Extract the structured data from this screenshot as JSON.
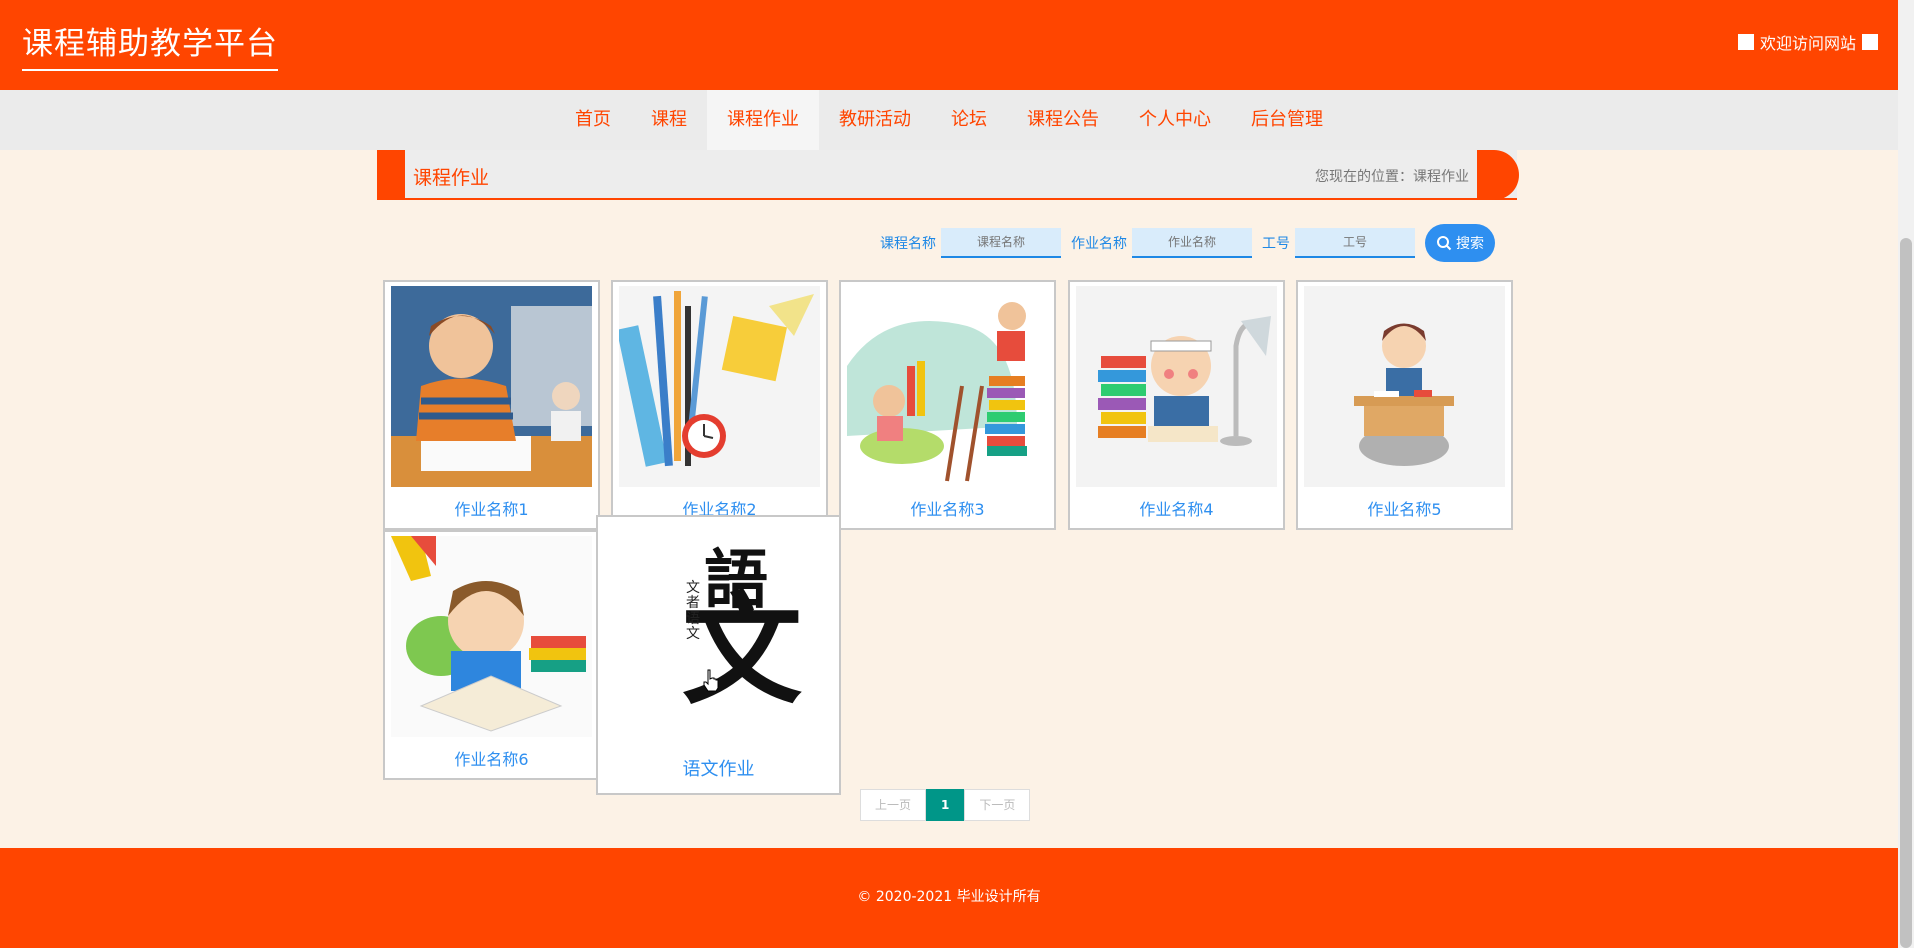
{
  "header": {
    "title": "课程辅助教学平台",
    "welcome": "欢迎访问网站"
  },
  "nav": {
    "items": [
      "首页",
      "课程",
      "课程作业",
      "教研活动",
      "论坛",
      "课程公告",
      "个人中心",
      "后台管理"
    ],
    "active": "课程作业"
  },
  "breadcrumb": {
    "title": "课程作业",
    "location": "您现在的位置：课程作业"
  },
  "search": {
    "course_label": "课程名称",
    "course_placeholder": "课程名称",
    "homework_label": "作业名称",
    "homework_placeholder": "作业名称",
    "id_label": "工号",
    "id_placeholder": "工号",
    "button": "搜索"
  },
  "cards": [
    {
      "caption": "作业名称1"
    },
    {
      "caption": "作业名称2"
    },
    {
      "caption": "作业名称3"
    },
    {
      "caption": "作业名称4"
    },
    {
      "caption": "作业名称5"
    },
    {
      "caption": "作业名称6"
    },
    {
      "caption": "语文作业",
      "image_chars": "語文",
      "image_small_text": "文者 语文"
    }
  ],
  "pager": {
    "prev": "上一页",
    "current": "1",
    "next": "下一页"
  },
  "footer": {
    "copyright": "© 2020-2021 毕业设计所有"
  },
  "colors": {
    "primary": "#ff4500",
    "link": "#2e8ff0",
    "page_bg": "#fcf2e6",
    "pager_active": "#009688"
  }
}
